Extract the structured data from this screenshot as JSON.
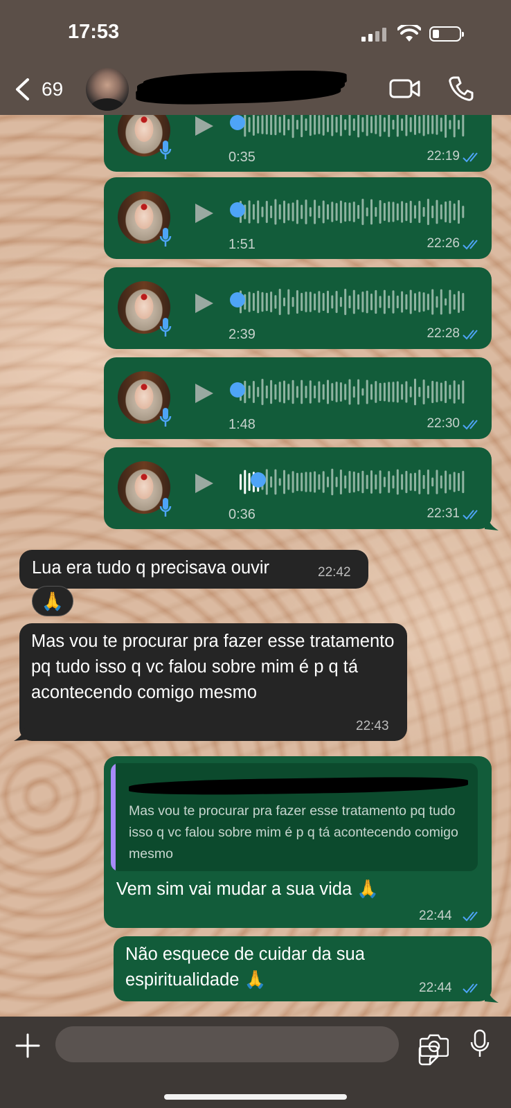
{
  "status_bar": {
    "time": "17:53"
  },
  "header": {
    "back_count": "69"
  },
  "voice_messages": [
    {
      "duration": "0:35",
      "time": "22:19"
    },
    {
      "duration": "1:51",
      "time": "22:26"
    },
    {
      "duration": "2:39",
      "time": "22:28"
    },
    {
      "duration": "1:48",
      "time": "22:30"
    },
    {
      "duration": "0:36",
      "time": "22:31"
    }
  ],
  "incoming": [
    {
      "text": "Lua era tudo q precisava ouvir",
      "time": "22:42",
      "reaction": "🙏"
    },
    {
      "text": "Mas vou te procurar pra fazer esse tratamento pq tudo isso q vc falou sobre mim é p q tá acontecendo comigo mesmo",
      "time": "22:43"
    }
  ],
  "outgoing": [
    {
      "quote": "Mas vou te procurar pra fazer esse tratamento pq tudo isso q vc falou sobre mim é p q tá acontecendo comigo mesmo",
      "text": "Vem sim vai mudar a sua vida 🙏",
      "time": "22:44"
    },
    {
      "text": "Não esquece de cuidar da sua espiritualidade 🙏",
      "time": "22:44"
    }
  ],
  "colors": {
    "outgoing_bubble": "#125c3a",
    "incoming_bubble": "#252525",
    "read_ticks": "#4ea4f7",
    "quote_bar": "#a78bfa"
  }
}
